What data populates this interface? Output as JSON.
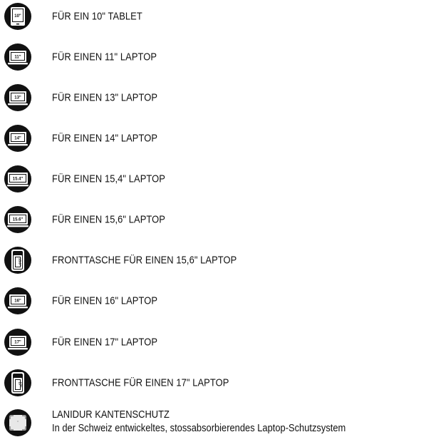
{
  "items": [
    {
      "icon": "tablet-icon",
      "badge": "10\"",
      "label": "FÜR EIN 10\" TABLET"
    },
    {
      "icon": "laptop-icon",
      "badge": "11\"",
      "label": "FÜR EINEN 11\" LAPTOP"
    },
    {
      "icon": "laptop-icon",
      "badge": "13\"",
      "label": "FÜR EINEN 13\" LAPTOP"
    },
    {
      "icon": "laptop-icon",
      "badge": "14\"",
      "label": "FÜR EINEN 14\" LAPTOP"
    },
    {
      "icon": "laptop-icon",
      "badge": "15.4\"",
      "label": "FÜR EINEN 15,4\" LAPTOP"
    },
    {
      "icon": "laptop-icon",
      "badge": "15.6\"",
      "label": "FÜR EINEN 15,6\" LAPTOP"
    },
    {
      "icon": "front-pocket-icon",
      "badge": "15.6\"",
      "label": "FRONTTASCHE FÜR EINEN 15,6\" LAPTOP"
    },
    {
      "icon": "laptop-icon",
      "badge": "16\"",
      "label": "FÜR EINEN 16\" LAPTOP"
    },
    {
      "icon": "laptop-icon",
      "badge": "17\"",
      "label": "FÜR EINEN 17\" LAPTOP"
    },
    {
      "icon": "front-pocket-icon",
      "badge": "17\"",
      "label": "FRONTTASCHE FÜR EINEN 17\" LAPTOP"
    }
  ],
  "last": {
    "icon": "edge-protection-icon",
    "title": "LANIDUR KANTENSCHUTZ",
    "subtitle": "In der Schweiz entwickeltes, stossabsorbierendes Laptop-Schutzsystem"
  },
  "colors": {
    "icon_bg": "#111111",
    "icon_fg": "#ffffff",
    "text": "#111111"
  }
}
